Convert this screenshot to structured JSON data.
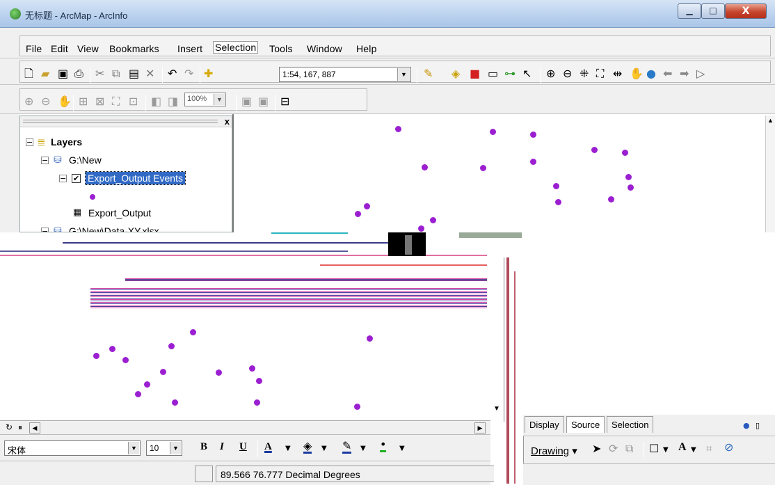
{
  "window": {
    "title": "无标题 - ArcMap - ArcInfo",
    "min_glyph": "▁",
    "max_glyph": "□",
    "close_glyph": "X"
  },
  "menu": [
    "File",
    "Edit",
    "View",
    "Bookmarks",
    "Insert",
    "Selection",
    "Tools",
    "Window",
    "Help"
  ],
  "toolbar": {
    "scale": "1:54, 167, 887",
    "zoom_percent": "100%"
  },
  "toc": {
    "close_glyph": "x",
    "root_label": "Layers",
    "group_label": "G:\\New",
    "layer_label": "Export_Output Events",
    "table_label": "Export_Output",
    "group2_label": "G:\\New\\Data-XY.xlsx"
  },
  "tabs": [
    "Display",
    "Source",
    "Selection"
  ],
  "format": {
    "font": "宋体",
    "size": "10",
    "bold": "B",
    "italic": "I",
    "underline": "U",
    "font_color_glyph": "A"
  },
  "drawing": {
    "menu_label": "Drawing"
  },
  "status": {
    "coordinates": "89.566  76.777 Decimal Degrees"
  },
  "colors": {
    "point": "#9b1fd1",
    "selection": "#316ac5"
  }
}
